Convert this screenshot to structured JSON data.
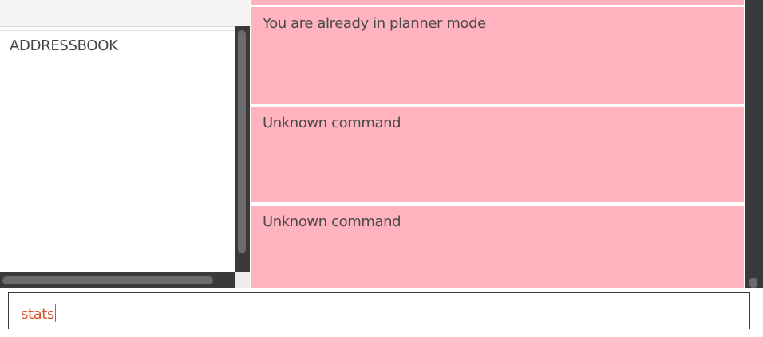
{
  "left_panel": {
    "list_items": [
      "ADDRESSBOOK"
    ]
  },
  "result_panel": {
    "messages": [
      {
        "text": "You are already in planner mode"
      },
      {
        "text": "Unknown command"
      },
      {
        "text": "Unknown command"
      }
    ],
    "background_color": "#ffb3be",
    "text_color": "#4a4a4a"
  },
  "command_box": {
    "value": "stats",
    "text_color": "#d9532e"
  }
}
